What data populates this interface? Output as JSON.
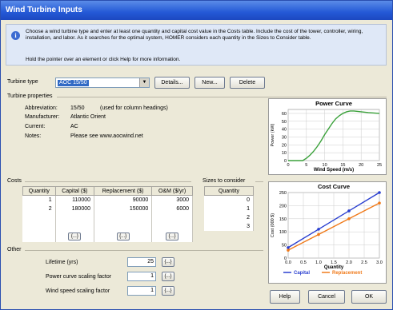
{
  "window": {
    "title": "Wind Turbine Inputs"
  },
  "info": {
    "text": "Choose a wind turbine type and enter at least one quantity and capital cost value in the Costs table. Include the cost of the tower, controller, wiring, installation, and labor. As it searches for the optimal system, HOMER considers each quantity in the Sizes to Consider table.",
    "hint": "Hold the pointer over an element or click Help for more information."
  },
  "turbine_type": {
    "label": "Turbine type",
    "value": "AOC 15/50"
  },
  "buttons": {
    "details": "Details...",
    "new": "New...",
    "delete": "Delete",
    "help": "Help",
    "cancel": "Cancel",
    "ok": "OK"
  },
  "properties": {
    "heading": "Turbine properties",
    "abbreviation_label": "Abbreviation:",
    "abbreviation_value": "15/50",
    "abbreviation_note": "(used for column headings)",
    "manufacturer_label": "Manufacturer:",
    "manufacturer_value": "Atlantic Orient",
    "current_label": "Current:",
    "current_value": "AC",
    "notes_label": "Notes:",
    "notes_value": "Please see www.aocwind.net"
  },
  "costs": {
    "heading": "Costs",
    "columns": [
      "Quantity",
      "Capital ($)",
      "Replacement ($)",
      "O&M ($/yr)"
    ],
    "rows": [
      [
        "1",
        "110000",
        "90000",
        "3000"
      ],
      [
        "2",
        "180000",
        "150000",
        "6000"
      ]
    ],
    "cell_button": "{...}"
  },
  "sizes": {
    "heading": "Sizes to consider",
    "column": "Quantity",
    "values": [
      "0",
      "1",
      "2",
      "3"
    ]
  },
  "other": {
    "heading": "Other",
    "lifetime_label": "Lifetime (yrs)",
    "lifetime_value": "25",
    "power_scaling_label": "Power curve scaling factor",
    "power_scaling_value": "1",
    "wind_scaling_label": "Wind speed scaling factor",
    "wind_scaling_value": "1",
    "button": "{...}"
  },
  "colors": {
    "title_blue": "#2459d6",
    "power_curve": "#3aa13a",
    "capital": "#2a3fd0",
    "replacement": "#f07a1a"
  },
  "chart_data": [
    {
      "type": "line",
      "title": "Power Curve",
      "xlabel": "Wind Speed (m/s)",
      "ylabel": "Power (kW)",
      "xlim": [
        0,
        25
      ],
      "ylim": [
        0,
        65
      ],
      "xticks": [
        0,
        5,
        10,
        15,
        20,
        25
      ],
      "yticks": [
        0,
        10,
        20,
        30,
        40,
        50,
        60
      ],
      "series": [
        {
          "name": "",
          "x": [
            0,
            4,
            5,
            6,
            7,
            8,
            9,
            10,
            11,
            12,
            13,
            14,
            15,
            16,
            17,
            18,
            20,
            22,
            25
          ],
          "y": [
            0,
            0,
            3,
            7,
            12,
            18,
            25,
            33,
            40,
            47,
            53,
            57,
            60,
            62,
            63,
            63,
            62,
            61,
            60
          ]
        }
      ]
    },
    {
      "type": "line",
      "title": "Cost Curve",
      "xlabel": "Quantity",
      "ylabel": "Cost (000 $)",
      "xlim": [
        0,
        3
      ],
      "ylim": [
        0,
        250
      ],
      "xticks": [
        "0.0",
        "0.5",
        "1.0",
        "1.5",
        "2.0",
        "2.5",
        "3.0"
      ],
      "yticks": [
        0,
        50,
        100,
        150,
        200,
        250
      ],
      "legend_position": "bottom",
      "series": [
        {
          "name": "Capital",
          "x": [
            0,
            1,
            2,
            3
          ],
          "y": [
            40,
            110,
            180,
            250
          ],
          "markers": true
        },
        {
          "name": "Replacement",
          "x": [
            0,
            1,
            2,
            3
          ],
          "y": [
            30,
            90,
            150,
            210
          ],
          "markers": true
        }
      ]
    }
  ]
}
